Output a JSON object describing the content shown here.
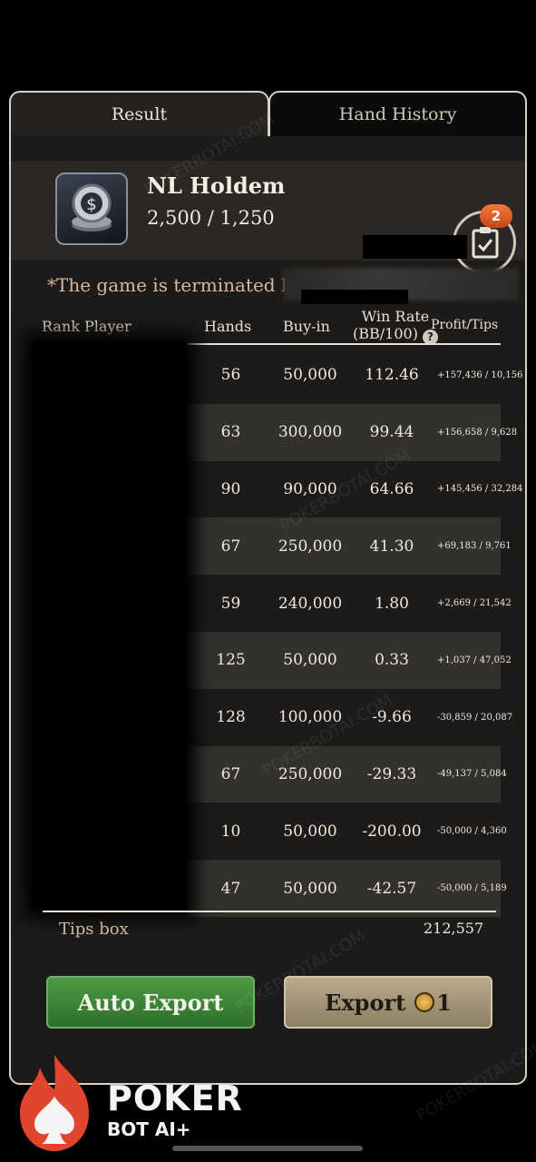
{
  "tabs": [
    {
      "label": "Result",
      "active": true
    },
    {
      "label": "Hand History",
      "active": false
    }
  ],
  "game": {
    "title": "NL Holdem",
    "blinds": "2,500 / 1,250",
    "notification_count": "2",
    "terminated_text": "*The game is terminated by"
  },
  "table": {
    "headers": {
      "rank_player": "Rank  Player",
      "hands": "Hands",
      "buyin": "Buy-in",
      "win_rate_line1": "Win Rate",
      "win_rate_line2": "(BB/100)",
      "profit_tips": "Profit/Tips"
    },
    "rows": [
      {
        "hands": "56",
        "buyin": "50,000",
        "win_rate": "112.46",
        "profit_tips": "+157,436 / 10,156"
      },
      {
        "hands": "63",
        "buyin": "300,000",
        "win_rate": "99.44",
        "profit_tips": "+156,658 / 9,628"
      },
      {
        "hands": "90",
        "buyin": "90,000",
        "win_rate": "64.66",
        "profit_tips": "+145,456 / 32,284"
      },
      {
        "hands": "67",
        "buyin": "250,000",
        "win_rate": "41.30",
        "profit_tips": "+69,183 / 9,761"
      },
      {
        "hands": "59",
        "buyin": "240,000",
        "win_rate": "1.80",
        "profit_tips": "+2,669 / 21,542"
      },
      {
        "hands": "125",
        "buyin": "50,000",
        "win_rate": "0.33",
        "profit_tips": "+1,037 / 47,052"
      },
      {
        "hands": "128",
        "buyin": "100,000",
        "win_rate": "-9.66",
        "profit_tips": "-30,859 / 20,087"
      },
      {
        "hands": "67",
        "buyin": "250,000",
        "win_rate": "-29.33",
        "profit_tips": "-49,137 / 5,084"
      },
      {
        "hands": "10",
        "buyin": "50,000",
        "win_rate": "-200.00",
        "profit_tips": "-50,000 / 4,360"
      },
      {
        "hands": "47",
        "buyin": "50,000",
        "win_rate": "-42.57",
        "profit_tips": "-50,000 / 5,189"
      }
    ],
    "tips_box_label": "Tips box",
    "tips_box_value": "212,557"
  },
  "buttons": {
    "auto_export": "Auto Export",
    "export": "Export",
    "export_cost": "1"
  },
  "watermark": "POKERBOTAI.COM",
  "brand": {
    "word": "POKER",
    "sub": "BOT AI+"
  },
  "colors": {
    "panel_bg": "#1d1b19",
    "auto_export_green": "#3f8a3a",
    "export_tan": "#a89a7a",
    "badge_orange": "#e0642a"
  }
}
